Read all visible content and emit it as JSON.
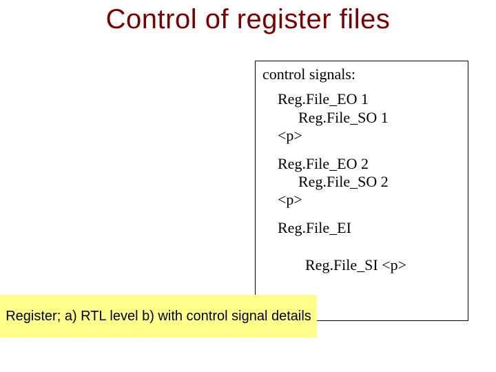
{
  "title": "Control of register files",
  "signals": {
    "heading": "control signals:",
    "group1": {
      "line1": "Reg.File_EO 1",
      "line2": "Reg.File_SO 1",
      "line3": "<p>"
    },
    "group2": {
      "line1": "Reg.File_EO 2",
      "line2": "Reg.File_SO 2",
      "line3": "<p>"
    },
    "single1": "Reg.File_EI",
    "single2": "Reg.File_SI <p>"
  },
  "caption": "Register; a) RTL level b) with control signal details"
}
